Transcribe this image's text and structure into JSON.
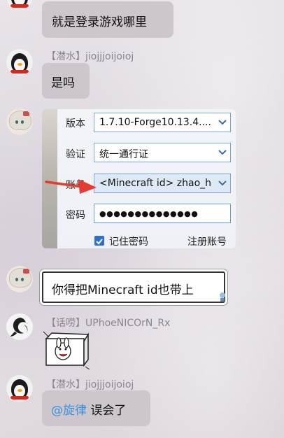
{
  "messages": [
    {
      "text": "就是登录游戏哪里"
    },
    {
      "role": "【潜水】",
      "username": "jiojjjoijoioj",
      "text": "是吗"
    },
    {
      "screenshot": {
        "rows": [
          {
            "label": "版本",
            "value": "1.7.10-Forge10.13.4...."
          },
          {
            "label": "验证",
            "value": "统一通行证"
          },
          {
            "label": "账号",
            "value": "<Minecraft id> zhao_h"
          },
          {
            "label": "密码",
            "value": "●●●●●●●●●●●●●●"
          }
        ],
        "remember_label": "记住密码",
        "register_label": "注册账号"
      }
    },
    {
      "text": "你得把Minecraft id也带上"
    },
    {
      "role": "【话唠】",
      "username": "UPhoeNICOrN_Rx"
    },
    {
      "role": "【潜水】",
      "username": "jiojjjoijoioj",
      "mention": "@旋律",
      "text": " 误会了"
    }
  ],
  "icons": {
    "penguin_avatar": "penguin-icon",
    "anime_avatar": "anime-girl-icon",
    "phoenix_avatar": "phoenix-icon",
    "sticker": "bunny-sticker-icon",
    "dropdown": "chevron-down-icon",
    "checkbox": "checkmark-icon",
    "red_arrow": "red-arrow-icon"
  },
  "colors": {
    "bubble": "#cdc7cd",
    "link": "#2b6fc7",
    "mention": "#3b8fd9",
    "arrow": "#e53b35"
  }
}
